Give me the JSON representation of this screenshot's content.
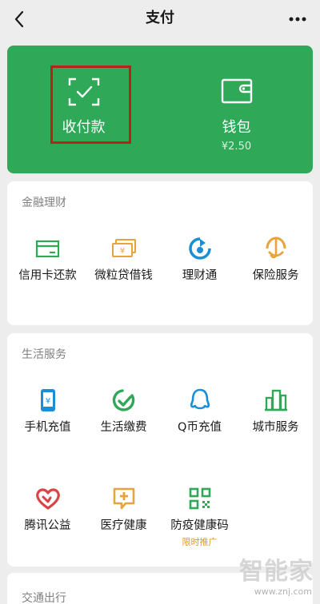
{
  "header": {
    "title": "支付",
    "back_icon": "chevron-left-icon",
    "more_icon": "more-dots-icon"
  },
  "pay_card": {
    "collect": {
      "label": "收付款",
      "icon": "scan-check-icon"
    },
    "wallet": {
      "label": "钱包",
      "balance": "¥2.50",
      "icon": "wallet-icon"
    },
    "accent": "#2fa858"
  },
  "finance": {
    "title": "金融理财",
    "items": [
      {
        "label": "信用卡还款",
        "icon": "credit-card-icon"
      },
      {
        "label": "微粒贷借钱",
        "icon": "cash-icon"
      },
      {
        "label": "理财通",
        "icon": "wealth-icon"
      },
      {
        "label": "保险服务",
        "icon": "umbrella-icon"
      }
    ]
  },
  "life": {
    "title": "生活服务",
    "items": [
      {
        "label": "手机充值",
        "icon": "phone-icon"
      },
      {
        "label": "生活缴费",
        "icon": "bill-check-icon"
      },
      {
        "label": "Q币充值",
        "icon": "qq-icon"
      },
      {
        "label": "城市服务",
        "icon": "city-icon"
      },
      {
        "label": "腾讯公益",
        "icon": "charity-heart-icon"
      },
      {
        "label": "医疗健康",
        "icon": "medical-icon"
      },
      {
        "label": "防疫健康码",
        "icon": "qr-code-icon",
        "promo": "限时推广"
      }
    ]
  },
  "transport": {
    "title": "交通出行"
  },
  "watermark": {
    "brand": "智能家",
    "url": "www.znj.com"
  }
}
